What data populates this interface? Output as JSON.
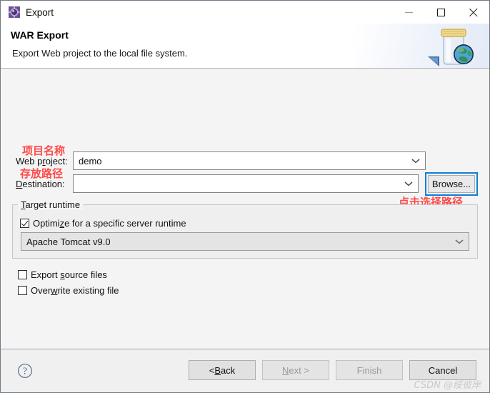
{
  "window": {
    "title": "Export",
    "icon": "eclipse-export-icon",
    "controls": {
      "minimize": "minimize-icon",
      "maximize": "maximize-icon",
      "close": "close-icon"
    }
  },
  "banner": {
    "title": "WAR Export",
    "subtitle": "Export Web project to the local file system.",
    "icon": "war-jar-globe-icon"
  },
  "form": {
    "web_project": {
      "label_pre": "Web p",
      "label_mn": "r",
      "label_post": "oject:",
      "value": "demo",
      "placeholder": ""
    },
    "destination": {
      "label_mn": "D",
      "label_post": "estination:",
      "value": "",
      "placeholder": ""
    },
    "browse_label": "Browse..."
  },
  "target_runtime": {
    "group_mn": "T",
    "group_post": "arget runtime",
    "optimize": {
      "label_pre": "Optimi",
      "label_mn": "z",
      "label_post": "e for a specific server runtime",
      "checked": true
    },
    "runtime_value": "Apache Tomcat v9.0"
  },
  "options": [
    {
      "label_pre": "Export ",
      "label_mn": "s",
      "label_post": "ource files",
      "checked": false
    },
    {
      "label_pre": "Over",
      "label_mn": "w",
      "label_post": "rite existing file",
      "checked": false
    }
  ],
  "annotations": [
    {
      "text": "项目名称"
    },
    {
      "text": "存放路径"
    },
    {
      "text": "点击选择路径"
    }
  ],
  "footer": {
    "help": "help-icon",
    "back_pre": "< ",
    "back_mn": "B",
    "back_post": "ack",
    "next_mn": "N",
    "next_post": "ext >",
    "finish": "Finish",
    "cancel": "Cancel"
  },
  "watermark": "CSDN @绥彼岸",
  "colors": {
    "accent_blue": "#0a7fd9",
    "annotation_red": "#ff4a4a",
    "dialog_bg": "#f4f4f4"
  }
}
